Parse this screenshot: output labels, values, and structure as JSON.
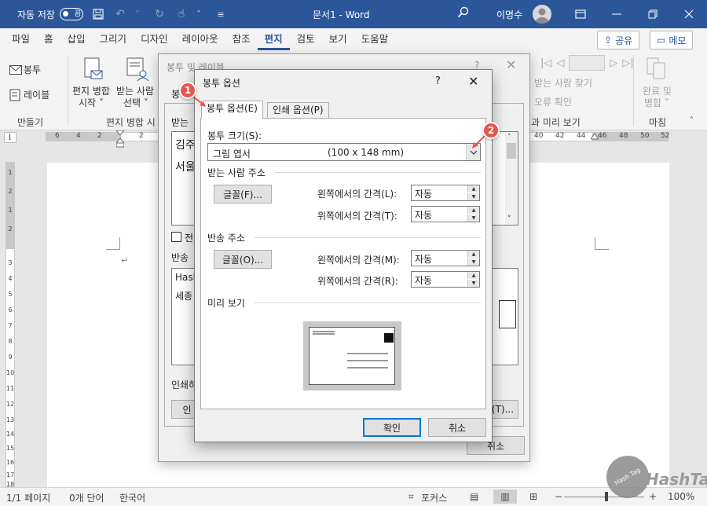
{
  "titlebar": {
    "autosave_label": "자동 저장",
    "autosave_state": "끔",
    "doc_title": "문서1  -  Word",
    "user_name": "이명수"
  },
  "tabs": [
    "파일",
    "홈",
    "삽입",
    "그리기",
    "디자인",
    "레이아웃",
    "참조",
    "편지",
    "검토",
    "보기",
    "도움말"
  ],
  "active_tab": "편지",
  "share_label": "공유",
  "memo_label": "메모",
  "ribbon": {
    "envelope_label": "봉투",
    "labels_label": "레이블",
    "group_create": "만들기",
    "merge_start_1": "편지 병합",
    "merge_start_2": "시작 ˅",
    "select_recipients_1": "받는 사람",
    "select_recipients_2": "선택 ˅",
    "group_merge_start": "편지 병합 시",
    "find_recipient": "받는 사람 찾기",
    "check_errors": "오류 확인",
    "group_preview": "과 미리 보기",
    "finish_1": "완료 및",
    "finish_2": "병합 ˅",
    "group_finish": "마침"
  },
  "ruler": {
    "h_numbers_left": [
      "6",
      "4",
      "2",
      "2"
    ],
    "h_numbers_right": [
      "40",
      "42",
      "44",
      "46",
      "48",
      "50",
      "52"
    ],
    "v_numbers": [
      "1",
      "2",
      "1",
      "2",
      "3",
      "4",
      "5",
      "6",
      "7",
      "8",
      "9",
      "10",
      "11",
      "12",
      "13",
      "14",
      "15",
      "16",
      "17",
      "18"
    ]
  },
  "status": {
    "page": "1/1 페이지",
    "words": "0개 단어",
    "lang": "한국어",
    "focus": "포커스",
    "zoom": "100%"
  },
  "back_dialog": {
    "title": "봉투 및 레이블",
    "tab_partial": "봉",
    "recipient_label": "받는",
    "recipient_text_1": "김주",
    "recipient_text_2": "서울",
    "omit_label": "전",
    "return_label": "반송",
    "return_text_1": "Hash",
    "return_text_2": "세종",
    "print_label": "인쇄하",
    "add_btn": "인",
    "options_btn": "(T)...",
    "cancel_btn": "취소"
  },
  "dialog": {
    "title": "봉투 옵션",
    "help": "?",
    "tab_envelope": "봉투 옵션(E)",
    "tab_print": "인쇄 옵션(P)",
    "size_label": "봉투 크기(S):",
    "size_value": "그림 엽서",
    "size_dims": "(100 x 148 mm)",
    "recipient_section": "받는 사람 주소",
    "recipient_font_btn": "글꼴(F)...",
    "recipient_left_label": "왼쪽에서의 간격(L):",
    "recipient_left_value": "자동",
    "recipient_top_label": "위쪽에서의 간격(T):",
    "recipient_top_value": "자동",
    "return_section": "반송 주소",
    "return_font_btn": "글꼴(O)...",
    "return_left_label": "왼쪽에서의 간격(M):",
    "return_left_value": "자동",
    "return_top_label": "위쪽에서의 간격(R):",
    "return_top_value": "자동",
    "preview_section": "미리 보기",
    "ok_btn": "확인",
    "cancel_btn": "취소"
  },
  "badges": [
    "1",
    "2"
  ],
  "watermark": {
    "text": "HashTag",
    "logo_text": "Hash Tag"
  },
  "colors": {
    "word_blue": "#2b579a",
    "badge_red": "#e8554e",
    "focus_blue": "#0078d7"
  }
}
